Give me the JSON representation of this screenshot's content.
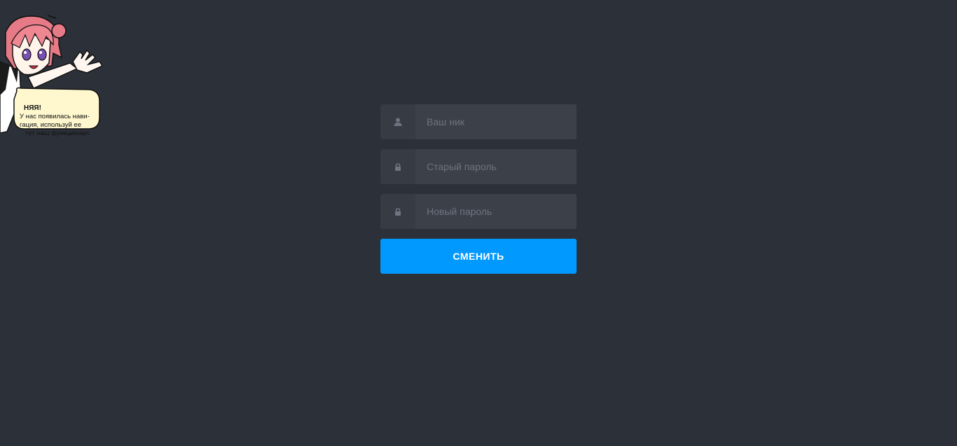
{
  "mascot": {
    "bubble_title": "НЯЯ!",
    "bubble_line1": "У нас появилась нави-",
    "bubble_line2": "гация, используй ее",
    "bubble_line3": "тут наш функционал"
  },
  "form": {
    "nick_placeholder": "Ваш ник",
    "old_password_placeholder": "Старый пароль",
    "new_password_placeholder": "Новый пароль",
    "submit_label": "СМЕНИТЬ"
  },
  "colors": {
    "background": "#2c3139",
    "field_bg": "#3b4049",
    "icon_bg": "#363b44",
    "accent": "#0299ff"
  }
}
